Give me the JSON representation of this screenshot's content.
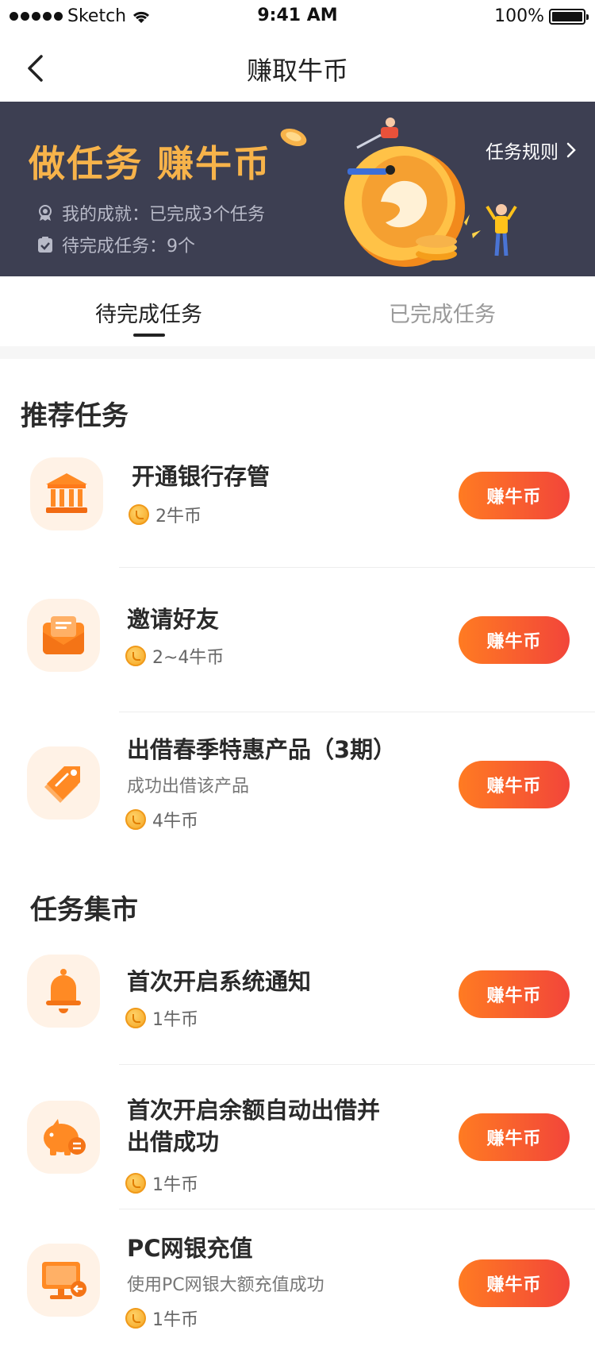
{
  "status_bar": {
    "carrier": "Sketch",
    "time": "9:41 AM",
    "battery": "100%"
  },
  "nav": {
    "title": "赚取牛币"
  },
  "banner": {
    "headline": "做任务 赚牛币",
    "achievement": "我的成就：已完成3个任务",
    "pending": "待完成任务：9个",
    "rules_link": "任务规则"
  },
  "tabs": {
    "pending": "待完成任务",
    "completed": "已完成任务"
  },
  "sections": {
    "recommended": {
      "title": "推荐任务",
      "tasks": [
        {
          "name": "开通银行存管",
          "reward": "2牛币",
          "button": "赚牛币"
        },
        {
          "name": "邀请好友",
          "reward": "2~4牛币",
          "button": "赚牛币"
        },
        {
          "name": "出借春季特惠产品（3期）",
          "desc": "成功出借该产品",
          "reward": "4牛币",
          "button": "赚牛币"
        }
      ]
    },
    "market": {
      "title": "任务集市",
      "tasks": [
        {
          "name": "首次开启系统通知",
          "reward": "1牛币",
          "button": "赚牛币"
        },
        {
          "name_line1": "首次开启余额自动出借并",
          "name_line2": "出借成功",
          "reward": "1牛币",
          "button": "赚牛币"
        },
        {
          "name": "PC网银充值",
          "desc": "使用PC网银大额充值成功",
          "reward": "1牛币",
          "button": "赚牛币"
        }
      ]
    }
  },
  "colors": {
    "banner_bg": "#3d3f52",
    "headline": "#f7b34a",
    "button_start": "#ff7b22",
    "button_end": "#f2453a",
    "icon_bg": "#fff2e6"
  }
}
